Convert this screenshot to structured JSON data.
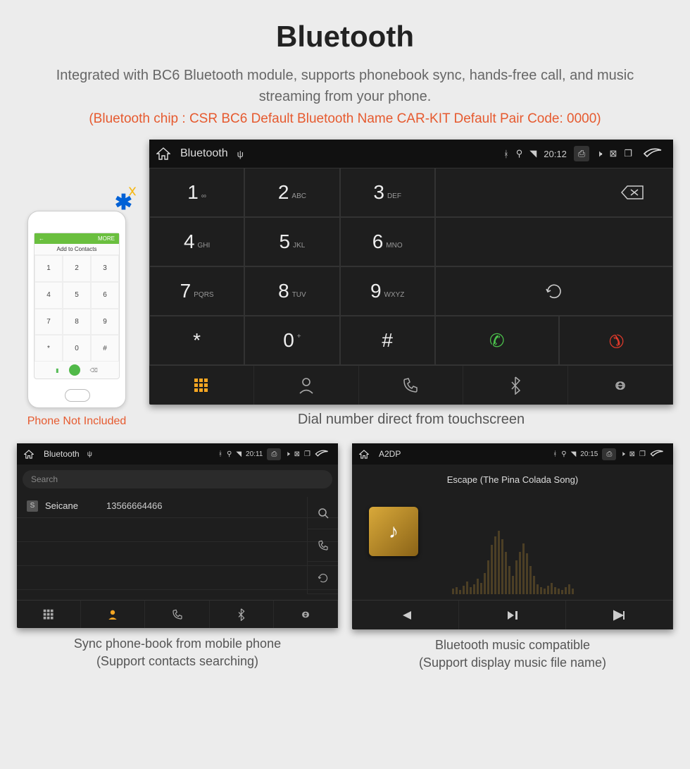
{
  "title": "Bluetooth",
  "subtitle": "Integrated with BC6 Bluetooth module, supports phonebook sync, hands-free call, and music streaming from your phone.",
  "specs": "(Bluetooth chip : CSR BC6     Default Bluetooth Name CAR-KIT     Default Pair Code: 0000)",
  "phone": {
    "greenbar_left": "←",
    "greenbar_right": "MORE",
    "add_contacts": "Add to Contacts",
    "label": "Phone Not Included"
  },
  "dialer": {
    "status": {
      "app": "Bluetooth",
      "time": "20:12"
    },
    "keys": [
      {
        "n": "1",
        "s": "∞"
      },
      {
        "n": "2",
        "s": "ABC"
      },
      {
        "n": "3",
        "s": "DEF"
      },
      {
        "n": "4",
        "s": "GHI"
      },
      {
        "n": "5",
        "s": "JKL"
      },
      {
        "n": "6",
        "s": "MNO"
      },
      {
        "n": "7",
        "s": "PQRS"
      },
      {
        "n": "8",
        "s": "TUV"
      },
      {
        "n": "9",
        "s": "WXYZ"
      },
      {
        "n": "*",
        "s": ""
      },
      {
        "n": "0",
        "s": "+"
      },
      {
        "n": "#",
        "s": ""
      }
    ],
    "caption": "Dial number direct from touchscreen"
  },
  "contacts": {
    "status": {
      "app": "Bluetooth",
      "time": "20:11"
    },
    "search_placeholder": "Search",
    "row": {
      "badge": "S",
      "name": "Seicane",
      "number": "13566664466"
    },
    "caption1": "Sync phone-book from mobile phone",
    "caption2": "(Support contacts searching)"
  },
  "music": {
    "status": {
      "app": "A2DP",
      "time": "20:15"
    },
    "song": "Escape (The Pina Colada Song)",
    "caption1": "Bluetooth music compatible",
    "caption2": "(Support display music file name)"
  }
}
